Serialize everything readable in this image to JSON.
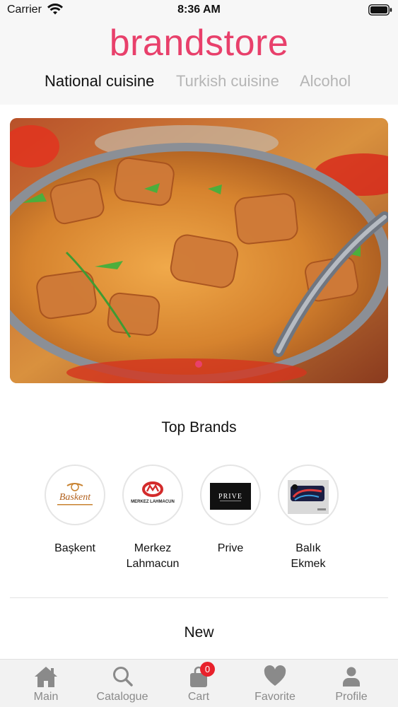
{
  "status_bar": {
    "carrier": "Carrier",
    "time": "8:36 AM"
  },
  "header": {
    "logo": "brandstore",
    "tabs": [
      {
        "label": "National cuisine",
        "active": true
      },
      {
        "label": "Turkish cuisine",
        "active": false
      },
      {
        "label": "Alcohol",
        "active": false
      }
    ]
  },
  "hero": {
    "image": "curry-dish-photo",
    "slide_count": 1,
    "active_slide": 1
  },
  "top_brands": {
    "title": "Top Brands",
    "items": [
      {
        "name": "Başkent",
        "logo_text": "Baskent"
      },
      {
        "name": "Merkez Lahmacun",
        "logo_text": "MERKEZ LAHMACUN"
      },
      {
        "name": "Prive",
        "logo_text": "PRIVE"
      },
      {
        "name": "Balık Ekmek",
        "logo_text": ""
      }
    ]
  },
  "new_section": {
    "title": "New"
  },
  "tabbar": {
    "items": [
      {
        "label": "Main",
        "icon": "home-icon",
        "active": true
      },
      {
        "label": "Catalogue",
        "icon": "search-icon",
        "active": false
      },
      {
        "label": "Cart",
        "icon": "shopping-bag-icon",
        "badge": "0",
        "active": false
      },
      {
        "label": "Favorite",
        "icon": "heart-icon",
        "active": false
      },
      {
        "label": "Profile",
        "icon": "user-icon",
        "active": false
      }
    ]
  },
  "colors": {
    "brand": "#e8406b",
    "badge": "#e8212b",
    "inactive_text": "#b5b5b5",
    "tab_icon": "#8a8a8a"
  }
}
